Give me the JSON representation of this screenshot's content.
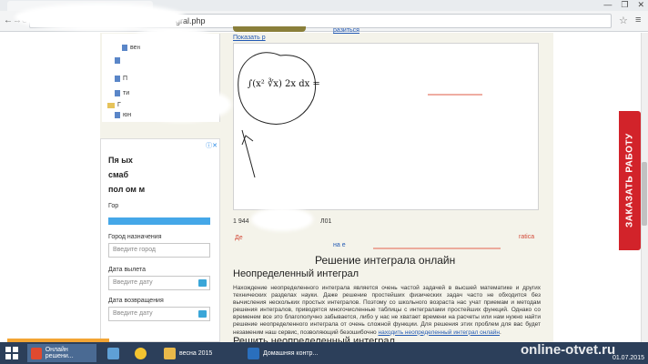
{
  "browser": {
    "url_fragment": "gral.php",
    "window_controls": [
      "—",
      "❐",
      "✕"
    ],
    "nav_back": "←",
    "nav_forward": "→",
    "reload": "C",
    "star": "☆",
    "menu": "≡"
  },
  "tree": {
    "items": [
      "вен",
      "",
      "П",
      "ти",
      "Г",
      "юн"
    ]
  },
  "ad": {
    "badge": "ⓘ✕",
    "headline": [
      "Пя     ых",
      "смаб",
      "пол  ом  м"
    ],
    "city_label": "Город назначения",
    "city_placeholder": "Введите город",
    "departure_label": "Дата вылета",
    "departure_placeholder": "Введите дату",
    "return_label": "Дата возвращения",
    "return_placeholder": "Введите дату",
    "from_label": "Гор"
  },
  "main": {
    "show_link": "Показать р",
    "top_link": "разиться",
    "formula": "∫(x² ∛x) 2x dx =",
    "under_box_text": "1 944",
    "under_box_text2": "Л01",
    "red_link_left": "Де",
    "red_link_right": "ratica",
    "red_link_mid": "на е",
    "title": "Решение интеграла онлайн",
    "subtitle": "Неопределенный интеграл",
    "paragraph": "Нахождение неопределенного интеграла является очень частой задачей в высшей математике и других технических разделах науки. Даже решение простейших физических задач часто не обходится без вычисления нескольких простых интегралов. Поэтому со школьного возраста нас учат приемам и методам решения интегралов, приводятся многочисленные таблицы с интегралами простейших функций. Однако со временем все это благополучно забывается, либо у нас не хватает времени на расчеты или нам нужно найти решение неопределенного интеграла от очень сложной функции. Для решения этих проблем для вас будет незаменим наш сервис, позволяющий безошибочно",
    "paragraph_link": "находить неопределенный интеграл онлайн",
    "subtitle2": "Решить неопределенный интеграл"
  },
  "order_tab": "ЗАКАЗАТЬ РАБОТУ",
  "taskbar": {
    "tasks": [
      {
        "label": "Онлайн решени...",
        "color": "#e04a2f"
      },
      {
        "label": "",
        "color": "#5fa0d6"
      },
      {
        "label": "",
        "color": "#f4c430"
      },
      {
        "label": "весна 2015",
        "color": "#e9b94a"
      },
      {
        "label": "Домашняя контр...",
        "color": "#2a6fbd"
      }
    ],
    "date": "01.07.2015"
  },
  "watermark": "online-otvet.ru"
}
